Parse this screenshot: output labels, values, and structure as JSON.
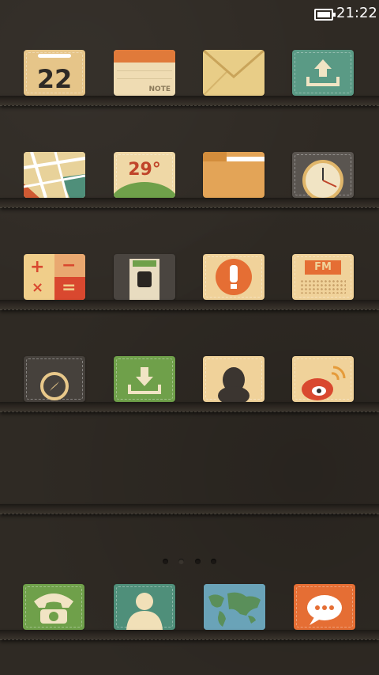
{
  "status": {
    "time": "21:22"
  },
  "apps": {
    "calendar": {
      "day": "22"
    },
    "notes": {
      "label": "NOTE"
    },
    "weather": {
      "temp": "29°"
    },
    "radio": {
      "label": "FM"
    }
  },
  "pager": {
    "pages": 4,
    "current": 2
  },
  "colors": {
    "background": "#2f2a24",
    "tan": "#e6c589",
    "green": "#6fa04a",
    "teal": "#4f8f7a",
    "orange": "#e56e34",
    "dark": "#4a4540"
  }
}
